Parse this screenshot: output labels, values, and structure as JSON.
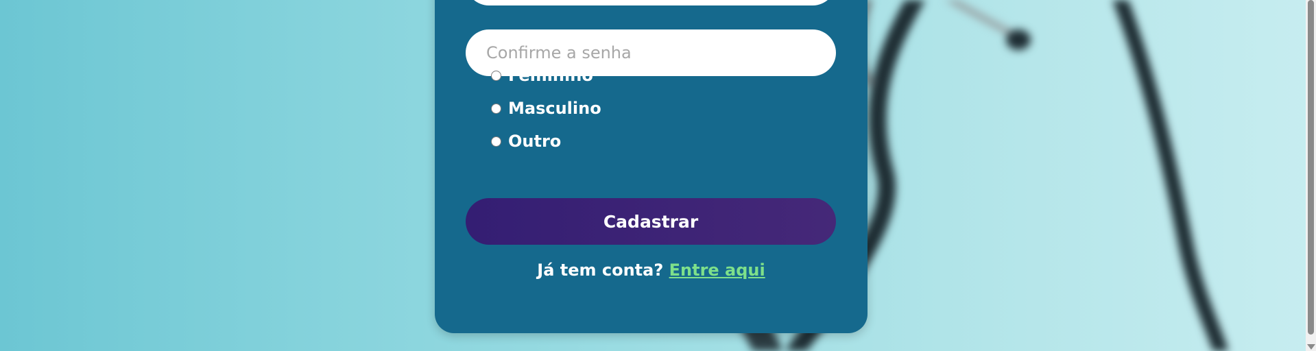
{
  "form": {
    "confirm_password_placeholder": "Confirme a senha",
    "gender_options": [
      "Feminino",
      "Masculino",
      "Outro"
    ],
    "submit_label": "Cadastrar",
    "login_prompt": "Já tem conta?",
    "login_link": "Entre aqui"
  },
  "colors": {
    "card": "#15698d",
    "button": "#341e73",
    "link": "#7ee08a",
    "background": "#86d3dc"
  },
  "icons": {
    "scroll_down": "chevron-down-icon"
  }
}
